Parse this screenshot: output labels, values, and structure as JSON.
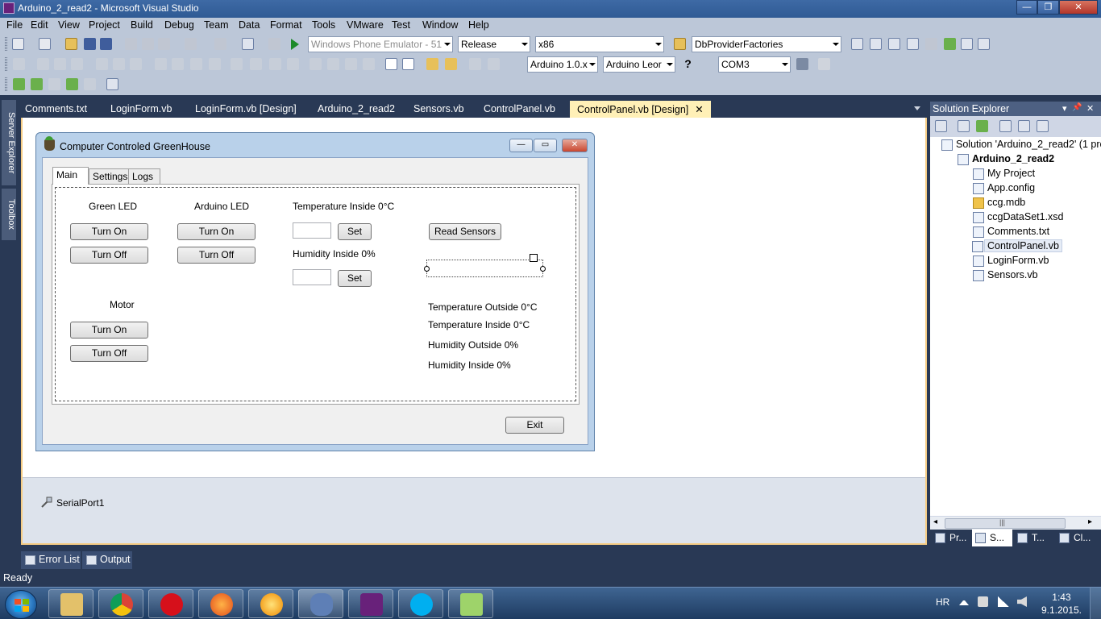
{
  "window": {
    "title": "Arduino_2_read2 - Microsoft Visual Studio",
    "minimize": "—",
    "maximize": "❐",
    "close": "✕"
  },
  "menu": [
    "File",
    "Edit",
    "View",
    "Project",
    "Build",
    "Debug",
    "Team",
    "Data",
    "Format",
    "Tools",
    "VMware",
    "Test",
    "Window",
    "Help"
  ],
  "toolbar": {
    "emulator": "Windows Phone Emulator - 51",
    "configuration": "Release",
    "platform": "x86",
    "find": "DbProviderFactories",
    "arduino_version": "Arduino 1.0.x",
    "board": "Arduino Leor",
    "port": "COM3",
    "help_icon": "?"
  },
  "side_tabs": [
    "Server Explorer",
    "Toolbox"
  ],
  "doc_tabs": [
    {
      "label": "Comments.txt"
    },
    {
      "label": "LoginForm.vb"
    },
    {
      "label": "LoginForm.vb [Design]"
    },
    {
      "label": "Arduino_2_read2"
    },
    {
      "label": "Sensors.vb"
    },
    {
      "label": "ControlPanel.vb"
    },
    {
      "label": "ControlPanel.vb [Design]",
      "close": "✕"
    }
  ],
  "form": {
    "title": "Computer Controled GreenHouse",
    "tabs": [
      "Main",
      "Settings",
      "Logs"
    ],
    "green_led_label": "Green LED",
    "arduino_led_label": "Arduino LED",
    "motor_label": "Motor",
    "turn_on": "Turn On",
    "turn_off": "Turn Off",
    "temperature_inside_set_label": "Temperature Inside 0°C",
    "humidity_inside_set_label": "Humidity Inside 0%",
    "set": "Set",
    "read_sensors": "Read Sensors",
    "readouts": {
      "temperature_outside": "Temperature Outside 0°C",
      "temperature_inside": "Temperature Inside 0°C",
      "humidity_outside": "Humidity Outside 0%",
      "humidity_inside": "Humidity Inside 0%"
    },
    "exit": "Exit",
    "minimize": "—",
    "maximize": "▭",
    "close": "✕"
  },
  "component_tray": {
    "serial_port": "SerialPort1"
  },
  "solution_explorer": {
    "title": "Solution Explorer",
    "pin": "📌",
    "close": "✕",
    "dropdown": "▾",
    "solution": "Solution 'Arduino_2_read2' (1 pro",
    "project": "Arduino_2_read2",
    "items": [
      "My Project",
      "App.config",
      "ccg.mdb",
      "ccgDataSet1.xsd",
      "Comments.txt",
      "ControlPanel.vb",
      "LoginForm.vb",
      "Sensors.vb"
    ],
    "selected_item": "ControlPanel.vb",
    "bottom_tabs": [
      "Pr...",
      "S...",
      "T...",
      "Cl..."
    ],
    "scroll_left": "◂",
    "scroll_right": "▸",
    "scroll_grip": "|||"
  },
  "bottom_tabs": [
    "Error List",
    "Output"
  ],
  "status": "Ready",
  "taskbar": {
    "language": "HR",
    "time": "1:43",
    "date": "9.1.2015."
  },
  "colors": {
    "vs_background": "#293955",
    "active_tab": "#fff0b7",
    "form_border": "#b9d1ea"
  }
}
